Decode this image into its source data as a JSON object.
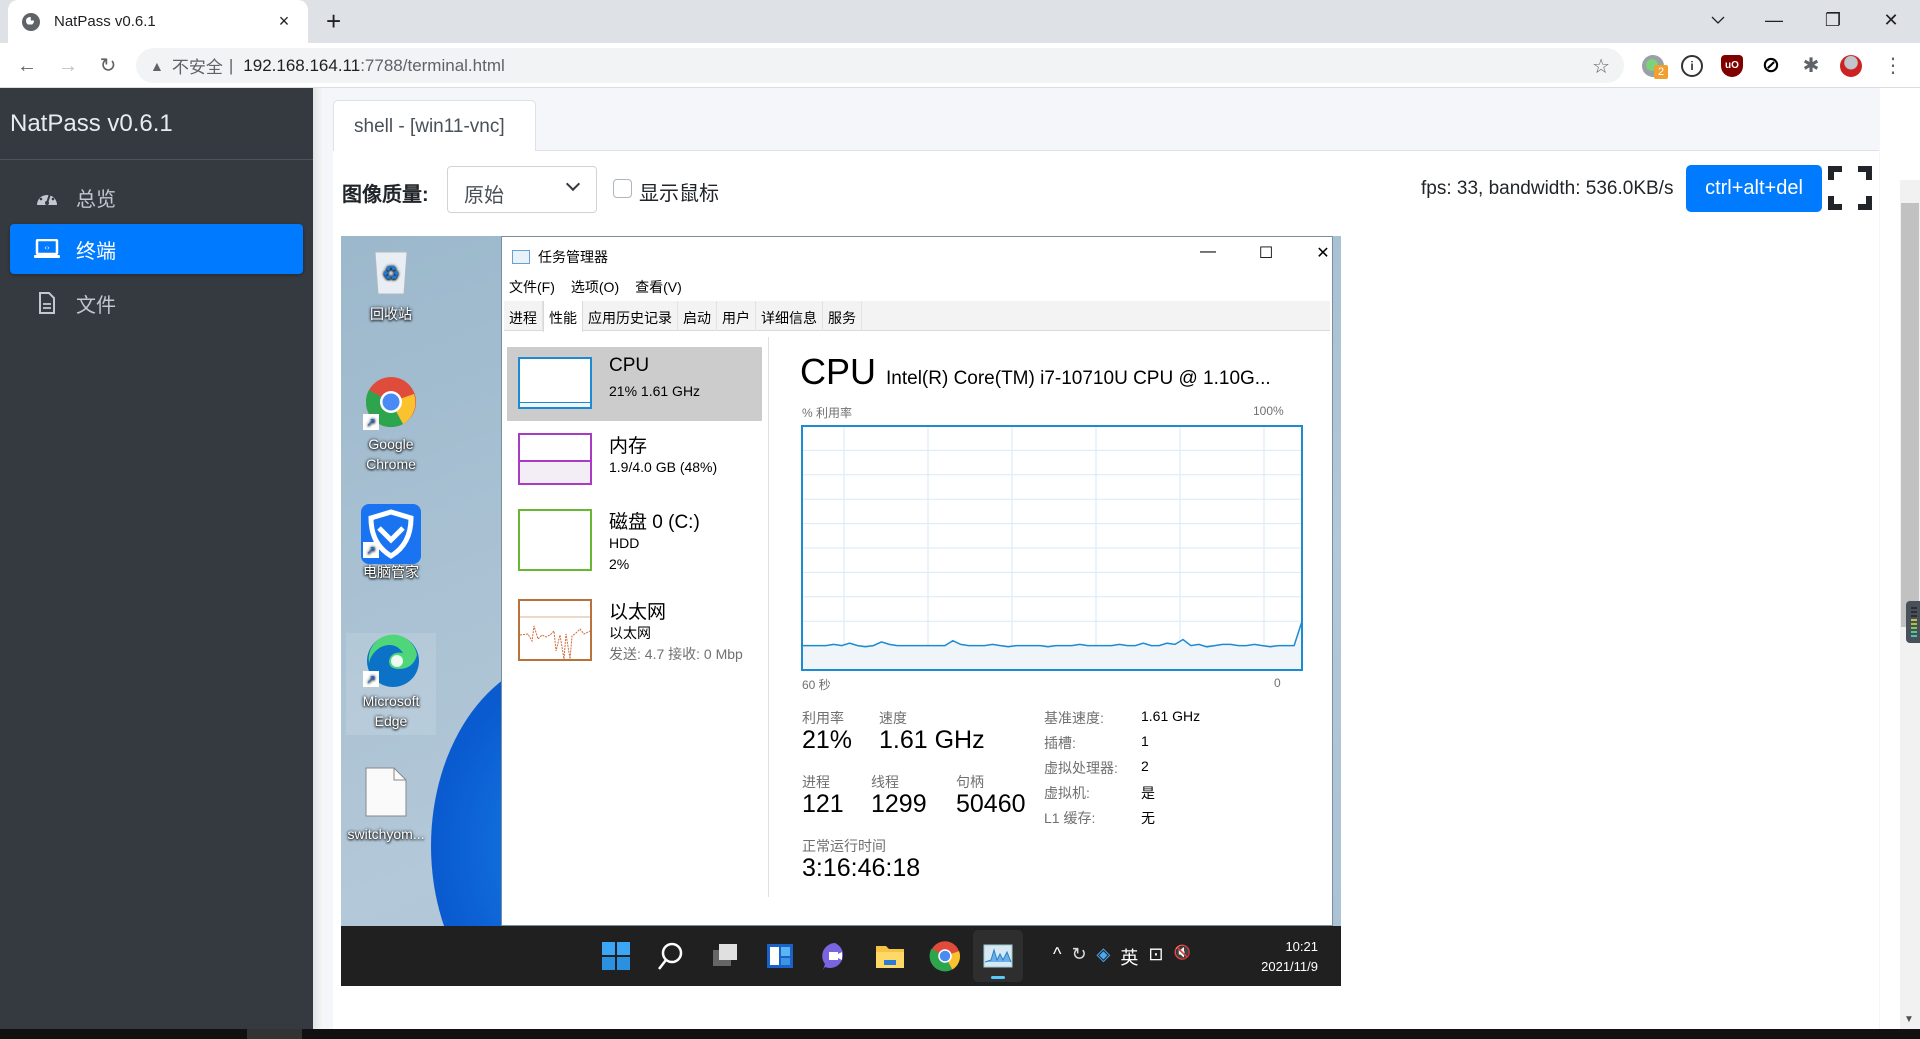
{
  "browser": {
    "tab_title": "NatPass v0.6.1",
    "tab_close": "×",
    "new_tab": "+",
    "window_controls": {
      "tab_search": "⌵",
      "minimize": "—",
      "restore": "❐",
      "close": "✕"
    },
    "nav": {
      "back": "←",
      "forward": "→",
      "reload": "↻"
    },
    "security_warning_icon": "▲",
    "security_text": "不安全",
    "separator": "|",
    "url_host": "192.168.164.11",
    "url_rest": ":7788/terminal.html",
    "bookmark_icon": "☆",
    "extensions": [
      {
        "name": "green-dot-extension",
        "badge": "2"
      },
      {
        "name": "1password-extension"
      },
      {
        "name": "ublock-origin-extension",
        "label": "uO"
      },
      {
        "name": "blocker-extension",
        "label": "⊘"
      },
      {
        "name": "extensions-puzzle",
        "label": "✱"
      },
      {
        "name": "profile-avatar"
      }
    ],
    "menu": "⋮"
  },
  "sidebar": {
    "brand": "NatPass v0.6.1",
    "items": [
      {
        "label": "总览",
        "icon": "dashboard-gauge-icon",
        "active": false
      },
      {
        "label": "终端",
        "icon": "laptop-code-icon",
        "active": true
      },
      {
        "label": "文件",
        "icon": "file-icon",
        "active": false
      }
    ]
  },
  "content": {
    "tab_label": "shell - [win11-vnc]",
    "quality_label": "图像质量:",
    "quality_value": "原始",
    "show_cursor_label": "显示鼠标",
    "show_cursor_checked": false,
    "stats": "fps: 33, bandwidth: 536.0KB/s",
    "cad_button": "ctrl+alt+del",
    "accent": "#007bff"
  },
  "remote": {
    "desktop_icons": [
      {
        "label": "回收站",
        "icon": "recycle-bin-icon"
      },
      {
        "label": "Google Chrome",
        "icon": "chrome-icon"
      },
      {
        "label": "电脑管家",
        "icon": "tencent-pc-manager-icon"
      },
      {
        "label": "Microsoft Edge",
        "icon": "edge-icon"
      },
      {
        "label": "switchyom...",
        "icon": "file-icon"
      }
    ],
    "task_manager": {
      "title": "任务管理器",
      "controls": {
        "minimize": "—",
        "maximize": "☐",
        "close": "✕"
      },
      "menu": [
        "文件(F)",
        "选项(O)",
        "查看(V)"
      ],
      "tabs": [
        "进程",
        "性能",
        "应用历史记录",
        "启动",
        "用户",
        "详细信息",
        "服务"
      ],
      "active_tab": "性能",
      "resources": [
        {
          "name": "CPU",
          "lines": [
            "21% 1.61 GHz"
          ],
          "color": "#1d8ad1",
          "selected": true
        },
        {
          "name": "内存",
          "lines": [
            "1.9/4.0 GB (48%)"
          ],
          "color": "#a93bc2",
          "selected": false,
          "fill_fraction": 0.48
        },
        {
          "name": "磁盘 0 (C:)",
          "lines": [
            "HDD",
            "2%"
          ],
          "color": "#67b832",
          "selected": false
        },
        {
          "name": "以太网",
          "lines": [
            "以太网",
            "发送: 4.7 接收: 0 Mbp"
          ],
          "color": "#b9723b",
          "selected": false
        }
      ],
      "cpu_heading": "CPU",
      "cpu_model": "Intel(R) Core(TM) i7-10710U CPU @ 1.10G...",
      "graph_label_left": "% 利用率",
      "graph_label_right": "100%",
      "time_left": "60 秒",
      "time_right": "0",
      "stats": {
        "util_label": "利用率",
        "util": "21%",
        "speed_label": "速度",
        "speed": "1.61 GHz",
        "proc_label": "进程",
        "proc": "121",
        "threads_label": "线程",
        "threads": "1299",
        "handles_label": "句柄",
        "handles": "50460",
        "uptime_label": "正常运行时间",
        "uptime": "3:16:46:18"
      },
      "details": [
        {
          "k": "基准速度:",
          "v": "1.61 GHz"
        },
        {
          "k": "插槽:",
          "v": "1"
        },
        {
          "k": "虚拟处理器:",
          "v": "2"
        },
        {
          "k": "虚拟机:",
          "v": "是"
        },
        {
          "k": "L1 缓存:",
          "v": "无"
        }
      ]
    },
    "taskbar": {
      "apps": [
        "start-icon",
        "search-icon",
        "task-view-icon",
        "widgets-icon",
        "teams-chat-icon",
        "file-explorer-icon",
        "chrome-icon",
        "task-manager-icon"
      ],
      "tray": [
        "^",
        "↻",
        "◈",
        "英",
        "⊡",
        "🔇"
      ],
      "time": "10:21",
      "date": "2021/11/9"
    }
  },
  "chart_data": {
    "type": "line",
    "title": "CPU % 利用率",
    "xlabel": "",
    "ylabel": "% 利用率",
    "x_range_label": [
      "60 秒",
      "0"
    ],
    "ylim": [
      0,
      100
    ],
    "grid": true,
    "x": [
      60,
      59,
      58,
      57,
      56,
      55,
      54,
      53,
      52,
      51,
      50,
      49,
      48,
      47,
      46,
      45,
      44,
      43,
      42,
      41,
      40,
      39,
      38,
      37,
      36,
      35,
      34,
      33,
      32,
      31,
      30,
      29,
      28,
      27,
      26,
      25,
      24,
      23,
      22,
      21,
      20,
      19,
      18,
      17,
      16,
      15,
      14,
      13,
      12,
      11,
      10,
      9,
      8,
      7,
      6,
      5,
      4,
      3,
      2,
      1,
      0
    ],
    "series": [
      {
        "name": "CPU",
        "color": "#1d8ad1",
        "values": [
          10,
          10,
          10,
          10,
          10.5,
          10,
          11,
          10,
          9.5,
          10,
          11.5,
          10.5,
          10,
          10,
          10,
          10,
          10,
          10,
          10,
          12,
          10.5,
          10,
          10,
          10,
          10.5,
          10,
          9.5,
          10,
          10,
          10,
          10,
          9.5,
          10,
          10,
          10,
          10.5,
          10,
          10,
          10,
          10,
          10.5,
          10,
          10,
          11,
          10,
          10,
          11,
          10.5,
          12.5,
          10,
          10.5,
          9.5,
          10,
          10.5,
          10.5,
          10,
          10,
          10.5,
          10,
          9.5,
          10,
          10,
          10,
          20
        ]
      }
    ]
  }
}
